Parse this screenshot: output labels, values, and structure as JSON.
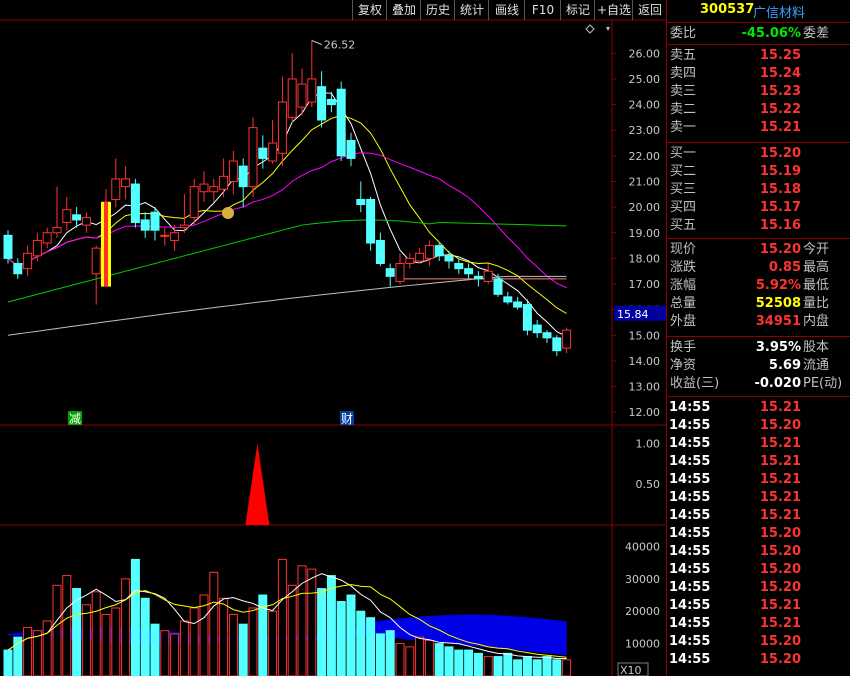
{
  "toolbar": {
    "buttons": [
      "复权",
      "叠加",
      "历史",
      "统计",
      "画线",
      "F10",
      "标记",
      "+自选",
      "返回"
    ]
  },
  "stock": {
    "code": "300537",
    "name": "广信材料"
  },
  "quote": {
    "weibi_label": "委比",
    "weibi_value": "-45.06%",
    "weicha_label": "委差",
    "sell": [
      {
        "label": "卖五",
        "price": "15.25"
      },
      {
        "label": "卖四",
        "price": "15.24"
      },
      {
        "label": "卖三",
        "price": "15.23"
      },
      {
        "label": "卖二",
        "price": "15.22"
      },
      {
        "label": "卖一",
        "price": "15.21"
      }
    ],
    "buy": [
      {
        "label": "买一",
        "price": "15.20"
      },
      {
        "label": "买二",
        "price": "15.19"
      },
      {
        "label": "买三",
        "price": "15.18"
      },
      {
        "label": "买四",
        "price": "15.17"
      },
      {
        "label": "买五",
        "price": "15.16"
      }
    ],
    "stats": [
      {
        "label": "现价",
        "value": "15.20",
        "right": "今开",
        "color": "red"
      },
      {
        "label": "涨跌",
        "value": "0.85",
        "right": "最高",
        "color": "red"
      },
      {
        "label": "涨幅",
        "value": "5.92%",
        "right": "最低",
        "color": "red"
      },
      {
        "label": "总量",
        "value": "52508",
        "right": "量比",
        "color": "yellow"
      },
      {
        "label": "外盘",
        "value": "34951",
        "right": "内盘",
        "color": "red"
      }
    ],
    "finance": [
      {
        "label": "换手",
        "value": "3.95%",
        "right": "股本"
      },
      {
        "label": "净资",
        "value": "5.69",
        "right": "流通"
      },
      {
        "label": "收益(三)",
        "value": "-0.020",
        "right": "PE(动)"
      }
    ]
  },
  "ticks": [
    {
      "time": "14:55",
      "price": "15.21"
    },
    {
      "time": "14:55",
      "price": "15.20"
    },
    {
      "time": "14:55",
      "price": "15.21"
    },
    {
      "time": "14:55",
      "price": "15.21"
    },
    {
      "time": "14:55",
      "price": "15.21"
    },
    {
      "time": "14:55",
      "price": "15.21"
    },
    {
      "time": "14:55",
      "price": "15.21"
    },
    {
      "time": "14:55",
      "price": "15.20"
    },
    {
      "time": "14:55",
      "price": "15.20"
    },
    {
      "time": "14:55",
      "price": "15.20"
    },
    {
      "time": "14:55",
      "price": "15.20"
    },
    {
      "time": "14:55",
      "price": "15.21"
    },
    {
      "time": "14:55",
      "price": "15.21"
    },
    {
      "time": "14:55",
      "price": "15.20"
    },
    {
      "time": "14:55",
      "price": "15.20"
    }
  ],
  "colors": {
    "up": "#ff3232",
    "down": "#54ffff",
    "border": "#8b0000",
    "ma5": "#ffffff",
    "ma10": "#ffff00",
    "ma20": "#ff00ff",
    "ma60": "#00cc00",
    "ma120": "#c0c0c0",
    "fill": "#0000ff"
  },
  "chart_data": {
    "type": "candlestick",
    "price_axis": {
      "ticks": [
        "26.00",
        "25.00",
        "24.00",
        "23.00",
        "22.00",
        "21.00",
        "20.00",
        "19.00",
        "18.00",
        "17.00",
        "16.00",
        "15.00",
        "14.00",
        "13.00",
        "12.00"
      ],
      "ylim": [
        11.5,
        27.3
      ]
    },
    "max_label": "26.52",
    "current_price_label": "15.84",
    "event_markers": [
      "减",
      "财"
    ],
    "candles": [
      {
        "o": 18.9,
        "c": 18.0,
        "h": 19.1,
        "l": 17.8
      },
      {
        "o": 17.8,
        "c": 17.4,
        "h": 18.0,
        "l": 17.2
      },
      {
        "o": 17.6,
        "c": 18.2,
        "h": 18.5,
        "l": 17.3
      },
      {
        "o": 18.1,
        "c": 18.7,
        "h": 19.0,
        "l": 17.9
      },
      {
        "o": 18.6,
        "c": 19.0,
        "h": 19.2,
        "l": 18.4
      },
      {
        "o": 19.0,
        "c": 19.2,
        "h": 20.8,
        "l": 18.8
      },
      {
        "o": 19.4,
        "c": 19.9,
        "h": 20.4,
        "l": 19.1
      },
      {
        "o": 19.7,
        "c": 19.5,
        "h": 20.0,
        "l": 19.2
      },
      {
        "o": 19.3,
        "c": 19.6,
        "h": 19.8,
        "l": 19.0
      },
      {
        "o": 17.4,
        "c": 18.4,
        "h": 18.5,
        "l": 16.2
      },
      {
        "o": 17.6,
        "c": 20.2,
        "h": 20.7,
        "l": 17.5
      },
      {
        "o": 20.3,
        "c": 21.1,
        "h": 21.9,
        "l": 20.0
      },
      {
        "o": 20.8,
        "c": 21.1,
        "h": 21.6,
        "l": 20.3
      },
      {
        "o": 20.9,
        "c": 19.4,
        "h": 21.1,
        "l": 19.2
      },
      {
        "o": 19.5,
        "c": 19.1,
        "h": 19.8,
        "l": 18.8
      },
      {
        "o": 19.8,
        "c": 19.1,
        "h": 20.0,
        "l": 18.7
      },
      {
        "o": 18.9,
        "c": 18.9,
        "h": 19.2,
        "l": 18.5
      },
      {
        "o": 18.7,
        "c": 19.0,
        "h": 19.3,
        "l": 18.3
      },
      {
        "o": 19.2,
        "c": 19.3,
        "h": 20.5,
        "l": 19.0
      },
      {
        "o": 19.6,
        "c": 20.8,
        "h": 21.1,
        "l": 19.3
      },
      {
        "o": 20.6,
        "c": 20.9,
        "h": 21.4,
        "l": 20.2
      },
      {
        "o": 20.6,
        "c": 20.8,
        "h": 21.1,
        "l": 20.2
      },
      {
        "o": 20.7,
        "c": 21.2,
        "h": 21.9,
        "l": 20.4
      },
      {
        "o": 21.0,
        "c": 21.8,
        "h": 22.2,
        "l": 20.5
      },
      {
        "o": 21.6,
        "c": 20.8,
        "h": 21.9,
        "l": 20.0
      },
      {
        "o": 20.8,
        "c": 23.1,
        "h": 23.5,
        "l": 20.4
      },
      {
        "o": 22.3,
        "c": 21.9,
        "h": 22.8,
        "l": 21.5
      },
      {
        "o": 21.8,
        "c": 22.5,
        "h": 23.4,
        "l": 21.7
      },
      {
        "o": 22.1,
        "c": 24.1,
        "h": 25.1,
        "l": 21.6
      },
      {
        "o": 23.5,
        "c": 25.0,
        "h": 26.0,
        "l": 23.3
      },
      {
        "o": 23.9,
        "c": 24.8,
        "h": 25.4,
        "l": 23.6
      },
      {
        "o": 24.1,
        "c": 25.0,
        "h": 26.5,
        "l": 23.9
      },
      {
        "o": 24.7,
        "c": 23.4,
        "h": 25.3,
        "l": 23.1
      },
      {
        "o": 24.2,
        "c": 24.0,
        "h": 24.5,
        "l": 23.7
      },
      {
        "o": 24.6,
        "c": 22.0,
        "h": 24.9,
        "l": 21.8
      },
      {
        "o": 22.6,
        "c": 21.9,
        "h": 22.9,
        "l": 21.6
      },
      {
        "o": 20.3,
        "c": 20.1,
        "h": 21.0,
        "l": 19.8
      },
      {
        "o": 20.3,
        "c": 18.6,
        "h": 20.4,
        "l": 18.3
      },
      {
        "o": 18.7,
        "c": 17.8,
        "h": 19.0,
        "l": 17.7
      },
      {
        "o": 17.6,
        "c": 17.3,
        "h": 17.8,
        "l": 16.9
      },
      {
        "o": 17.1,
        "c": 17.8,
        "h": 18.2,
        "l": 17.0
      },
      {
        "o": 17.8,
        "c": 18.0,
        "h": 18.2,
        "l": 17.6
      },
      {
        "o": 17.9,
        "c": 18.2,
        "h": 18.4,
        "l": 17.8
      },
      {
        "o": 18.0,
        "c": 18.5,
        "h": 18.7,
        "l": 17.7
      },
      {
        "o": 18.5,
        "c": 18.1,
        "h": 18.6,
        "l": 17.9
      },
      {
        "o": 18.1,
        "c": 17.9,
        "h": 18.3,
        "l": 17.6
      },
      {
        "o": 17.8,
        "c": 17.6,
        "h": 18.0,
        "l": 17.4
      },
      {
        "o": 17.6,
        "c": 17.4,
        "h": 17.8,
        "l": 17.2
      },
      {
        "o": 17.3,
        "c": 17.2,
        "h": 17.5,
        "l": 16.9
      },
      {
        "o": 17.1,
        "c": 17.5,
        "h": 17.8,
        "l": 17.0
      },
      {
        "o": 17.2,
        "c": 16.6,
        "h": 17.4,
        "l": 16.5
      },
      {
        "o": 16.5,
        "c": 16.3,
        "h": 16.7,
        "l": 16.2
      },
      {
        "o": 16.3,
        "c": 16.1,
        "h": 16.5,
        "l": 16.0
      },
      {
        "o": 16.2,
        "c": 15.2,
        "h": 16.4,
        "l": 15.0
      },
      {
        "o": 15.4,
        "c": 15.1,
        "h": 15.6,
        "l": 14.9
      },
      {
        "o": 15.1,
        "c": 14.9,
        "h": 15.2,
        "l": 14.7
      },
      {
        "o": 14.9,
        "c": 14.4,
        "h": 15.0,
        "l": 14.2
      },
      {
        "o": 14.5,
        "c": 15.2,
        "h": 15.3,
        "l": 14.3
      }
    ],
    "indicator_axis": {
      "ticks": [
        "1.00",
        "0.50"
      ],
      "ylim": [
        0,
        1.2
      ]
    },
    "indicator_spike": {
      "index": 28,
      "value": 1.0
    },
    "volume_axis": {
      "ticks": [
        "40000",
        "30000",
        "20000",
        "10000"
      ],
      "ylim": [
        0,
        46000
      ]
    },
    "volume_unit": "X10",
    "volumes": [
      8000,
      12000,
      15000,
      14000,
      17000,
      28000,
      31000,
      27000,
      22000,
      26000,
      19000,
      21000,
      30000,
      36000,
      24000,
      16000,
      14000,
      13000,
      17000,
      21000,
      25000,
      32000,
      24000,
      19000,
      16000,
      21000,
      25000,
      20000,
      36000,
      28000,
      34000,
      33000,
      27000,
      31000,
      23000,
      25000,
      20000,
      18000,
      13000,
      14000,
      10000,
      9000,
      12000,
      11000,
      10000,
      9000,
      8000,
      8000,
      7000,
      6000,
      6000,
      7000,
      5000,
      6000,
      5000,
      6000,
      5000,
      5000
    ]
  }
}
